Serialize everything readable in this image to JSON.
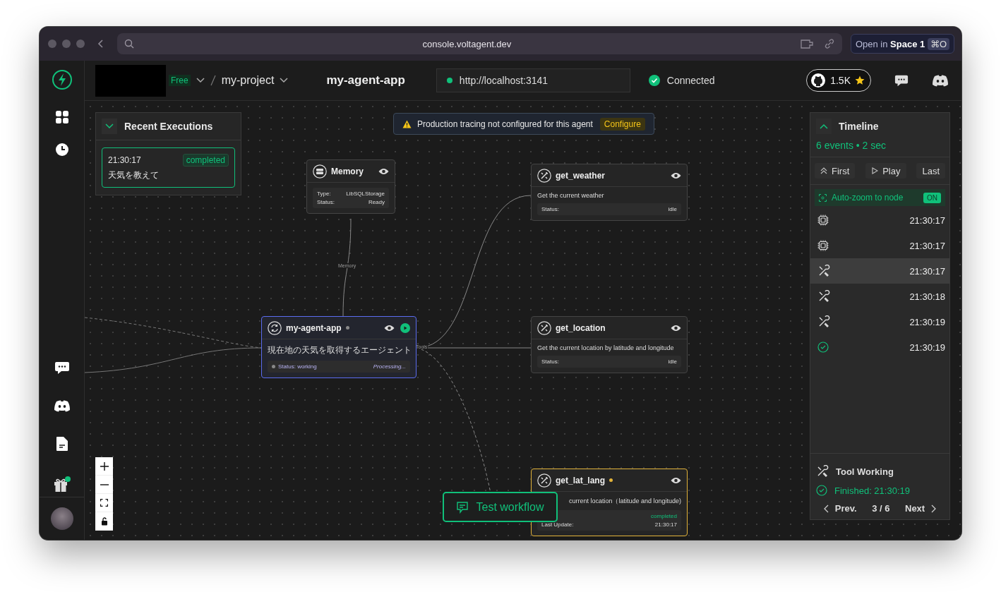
{
  "browser": {
    "url": "console.voltagent.dev",
    "space_button": {
      "prefix": "Open in",
      "space": "Space 1",
      "shortcut": "⌘O"
    }
  },
  "header": {
    "plan": "Free",
    "project": "my-project",
    "app": "my-agent-app",
    "server_url": "http://localhost:3141",
    "connection": "Connected",
    "stars": "1.5K"
  },
  "recent_executions": {
    "title": "Recent Executions",
    "items": [
      {
        "time": "21:30:17",
        "status": "completed",
        "message": "天気を教えて",
        "selected": true
      }
    ]
  },
  "banner": {
    "message": "Production tracing not configured for this agent",
    "action": "Configure"
  },
  "edge_labels": [
    "Memory",
    "Tools"
  ],
  "nodes": [
    {
      "kind": "memory",
      "title": "Memory",
      "selected": false,
      "running": false,
      "rows": [
        {
          "label": "Type:",
          "value": "LibSQLStorage",
          "success": false
        },
        {
          "label": "Status:",
          "value": "Ready",
          "success": false
        }
      ]
    },
    {
      "kind": "tool",
      "title": "get_weather",
      "selected": false,
      "running": false,
      "description": "Get the current weather",
      "rows": [
        {
          "label": "Status:",
          "value": "idle",
          "success": false
        }
      ]
    },
    {
      "kind": "agent",
      "title": "my-agent-app",
      "selected": true,
      "running": false,
      "description": "現在地の天気を取得するエージェント",
      "status": "Status: working",
      "progress": "Processing..."
    },
    {
      "kind": "tool",
      "title": "get_location",
      "selected": false,
      "running": false,
      "description": "Get the current location by latitude and longitude",
      "rows": [
        {
          "label": "Status:",
          "value": "idle",
          "success": false
        }
      ]
    },
    {
      "kind": "tool",
      "title": "get_lat_lang",
      "selected": false,
      "running": true,
      "description": "current location（latitude and longitude)",
      "rows": [
        {
          "value": "completed",
          "success": true
        },
        {
          "label": "Last Update:",
          "value": "21:30:17",
          "success": false
        }
      ]
    }
  ],
  "test_button": "Test workflow",
  "timeline": {
    "title": "Timeline",
    "summary": "6 events • 2 sec",
    "controls": [
      {
        "kind": "first",
        "label": "First"
      },
      {
        "kind": "play",
        "label": "Play"
      },
      {
        "kind": "last",
        "label": "Last"
      }
    ],
    "auto_zoom": {
      "label": "Auto-zoom to node",
      "toggle": "ON",
      "on": true
    },
    "events": [
      {
        "kind": "llm",
        "time": "21:30:17",
        "selected": false
      },
      {
        "kind": "llm",
        "time": "21:30:17",
        "selected": false
      },
      {
        "kind": "tool",
        "time": "21:30:17",
        "selected": true
      },
      {
        "kind": "tool",
        "time": "21:30:18",
        "selected": false
      },
      {
        "kind": "tool",
        "time": "21:30:19",
        "selected": false
      },
      {
        "kind": "done",
        "time": "21:30:19",
        "selected": false
      }
    ],
    "detail": {
      "title": "Tool Working",
      "finished": "Finished: 21:30:19"
    },
    "pager": {
      "prev": "Prev.",
      "position": "3 / 6",
      "next": "Next"
    }
  }
}
